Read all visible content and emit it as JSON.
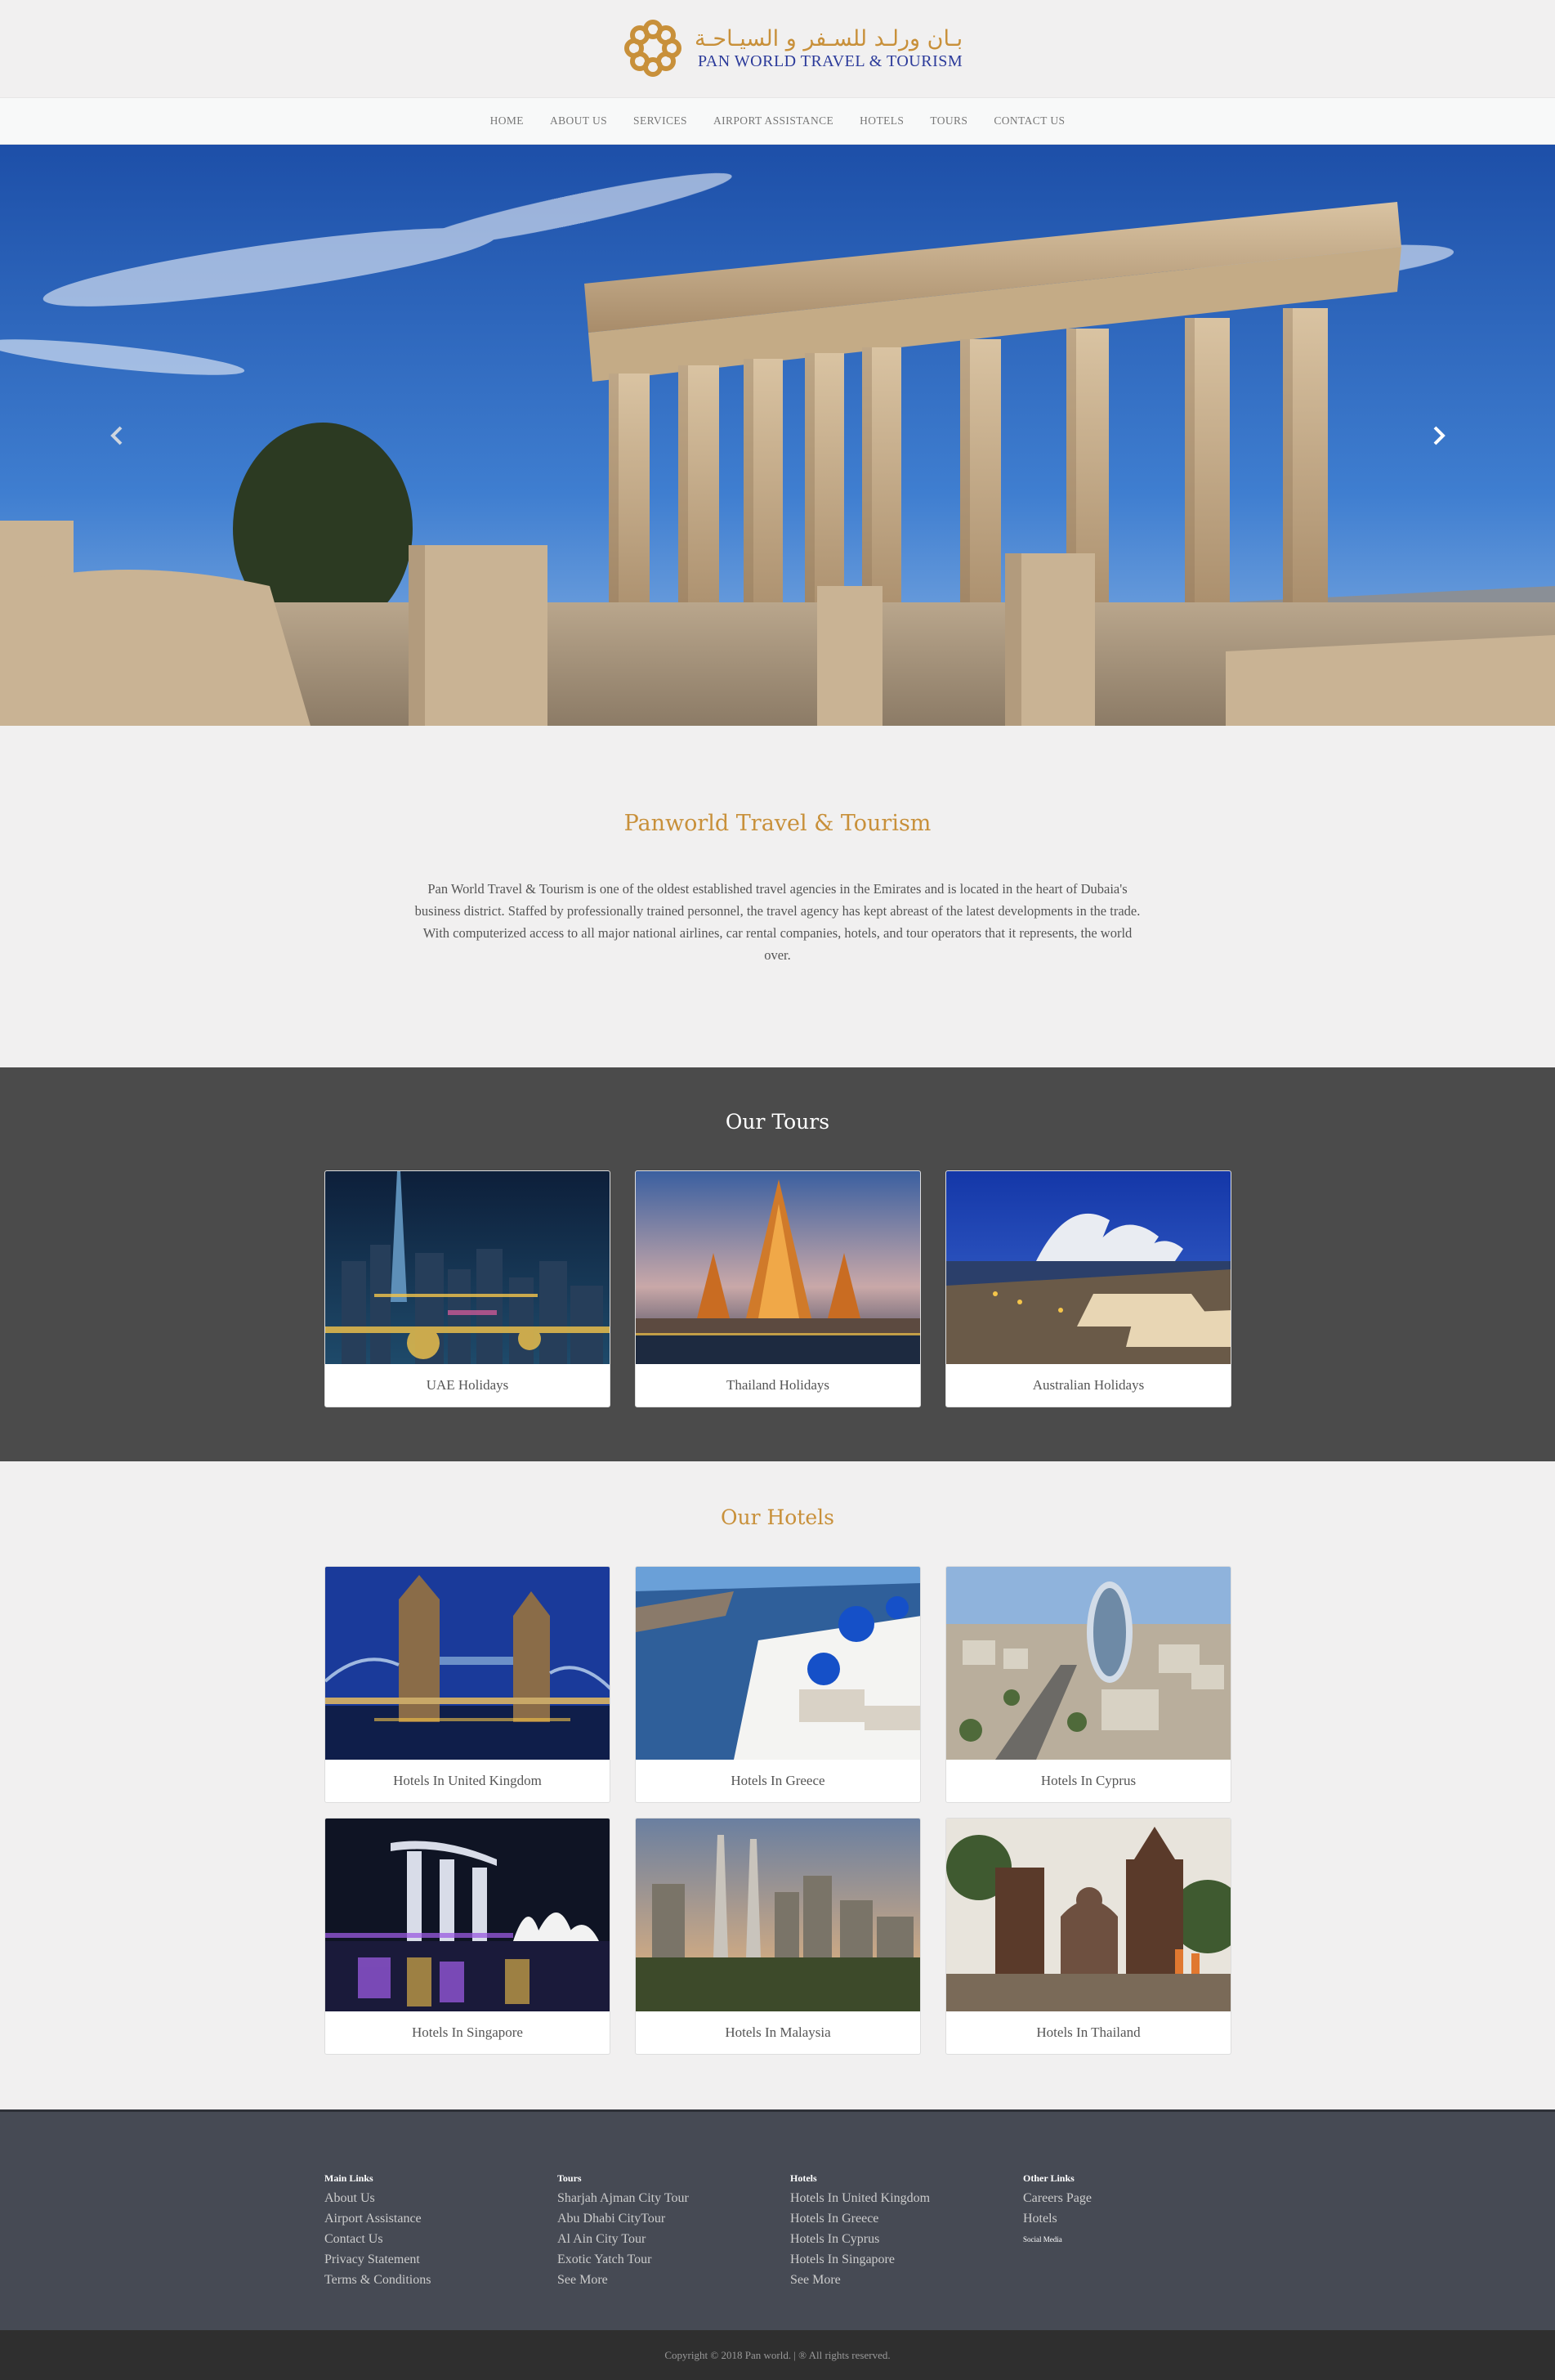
{
  "brand": {
    "arabic_name": "بـان ورلـد للسـفر و السيـاحـة",
    "english_name": "PAN WORLD TRAVEL & TOURISM",
    "logo_color": "#c8903a",
    "text_color": "#2b3a9a"
  },
  "nav": {
    "items": [
      "HOME",
      "ABOUT US",
      "SERVICES",
      "AIRPORT ASSISTANCE",
      "HOTELS",
      "TOURS",
      "CONTACT US"
    ]
  },
  "hero": {
    "prev_icon": "chevron-left-icon",
    "next_icon": "chevron-right-icon"
  },
  "about": {
    "title": "Panworld Travel & Tourism",
    "text": "Pan World Travel & Tourism is one of the oldest established travel agencies in the Emirates and is located in the heart of Dubaia's business district. Staffed by professionally trained personnel, the travel agency has kept abreast of the latest developments in the trade. With computerized access to all major national airlines, car rental companies, hotels, and tour operators that it represents, the world over."
  },
  "tours": {
    "title": "Our Tours",
    "items": [
      "UAE Holidays",
      "Thailand Holidays",
      "Australian Holidays"
    ]
  },
  "hotels": {
    "title": "Our Hotels",
    "items": [
      "Hotels In United Kingdom",
      "Hotels In Greece",
      "Hotels In Cyprus",
      "Hotels In Singapore",
      "Hotels In Malaysia",
      "Hotels In Thailand"
    ]
  },
  "footer": {
    "main_links": {
      "heading": "Main Links",
      "items": [
        "About Us",
        "Airport Assistance",
        "Contact Us",
        "Privacy Statement",
        "Terms & Conditions"
      ]
    },
    "tours": {
      "heading": "Tours",
      "items": [
        "Sharjah Ajman City Tour",
        "Abu Dhabi CityTour",
        "Al Ain City Tour",
        "Exotic Yatch Tour",
        "See More"
      ]
    },
    "hotels": {
      "heading": "Hotels",
      "items": [
        "Hotels In United Kingdom",
        "Hotels In Greece",
        "Hotels In Cyprus",
        "Hotels In Singapore",
        "See More"
      ]
    },
    "other_links": {
      "heading": "Other Links",
      "items": [
        "Careers Page",
        "Hotels"
      ],
      "social_label": "Social Media"
    },
    "copyright": "Copyright © 2018 Pan world. | ® All rights reserved."
  }
}
